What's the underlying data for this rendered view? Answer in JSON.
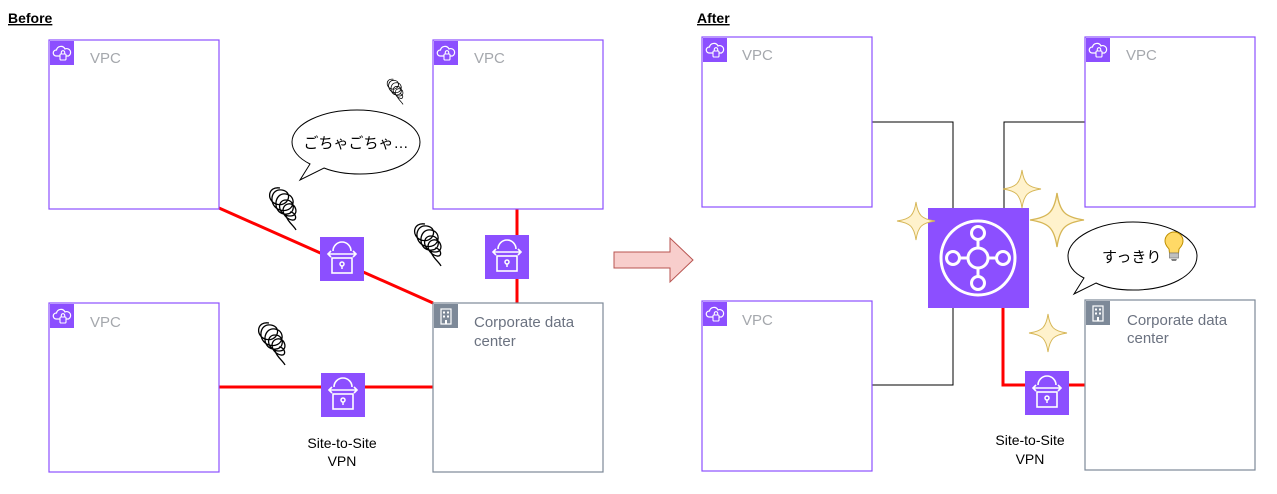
{
  "before": {
    "heading": "Before",
    "vpc_label": "VPC",
    "dc_label_line1": "Corporate data",
    "dc_label_line2": "center",
    "vpn_caption_line1": "Site-to-Site",
    "vpn_caption_line2": "VPN",
    "bubble": "ごちゃごちゃ…"
  },
  "after": {
    "heading": "After",
    "vpc_label": "VPC",
    "dc_label_line1": "Corporate data",
    "dc_label_line2": "center",
    "vpn_caption_line1": "Site-to-Site",
    "vpn_caption_line2": "VPN",
    "bubble": "すっきり"
  },
  "colors": {
    "vpc_border": "#8c4fff",
    "vpc_icon_bg": "#8c4fff",
    "dc_border": "#7d8998",
    "dc_icon_bg": "#7d8998",
    "vpn_connection": "#ff0000",
    "tgw_attachment": "#000000",
    "vpn_icon_bg": "#8c4fff",
    "transit_gateway_bg": "#8c4fff",
    "arrow_fill": "#f8cecc",
    "arrow_stroke": "#b85450",
    "sparkle_fill": "#fff2cc",
    "sparkle_stroke": "#d6b656"
  },
  "icons": {
    "vpc": "vpc-cloud-lock-icon",
    "datacenter": "corporate-building-icon",
    "vpn": "vpn-gateway-lock-icon",
    "tgw": "transit-gateway-hub-icon",
    "messy": "scribble-icon",
    "idea": "lightbulb-icon",
    "sparkle": "sparkle-icon"
  }
}
